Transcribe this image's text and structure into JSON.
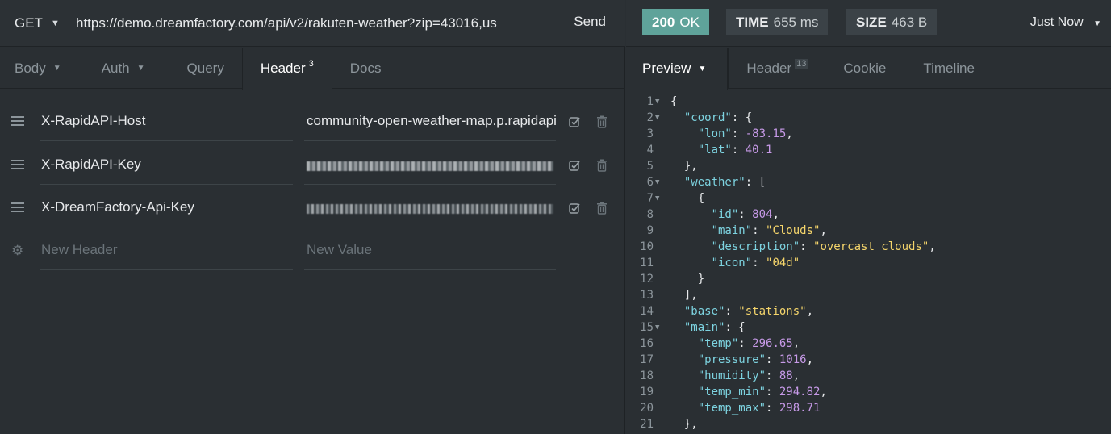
{
  "request": {
    "method": "GET",
    "url": "https://demo.dreamfactory.com/api/v2/rakuten-weather?zip=43016,us",
    "send_label": "Send"
  },
  "left_tabs": [
    {
      "label": "Body"
    },
    {
      "label": "Auth"
    },
    {
      "label": "Query"
    },
    {
      "label": "Header",
      "count": "3"
    },
    {
      "label": "Docs"
    }
  ],
  "headers": [
    {
      "name": "X-RapidAPI-Host",
      "value": "community-open-weather-map.p.rapidapi.com"
    },
    {
      "name": "X-RapidAPI-Key",
      "value": ""
    },
    {
      "name": "X-DreamFactory-Api-Key",
      "value": ""
    }
  ],
  "new_header": {
    "name_placeholder": "New Header",
    "value_placeholder": "New Value"
  },
  "response": {
    "status_code": "200",
    "status_text": "OK",
    "time_label": "TIME",
    "time_value": "655 ms",
    "size_label": "SIZE",
    "size_value": "463 B",
    "history": "Just Now"
  },
  "right_tabs": [
    {
      "label": "Preview"
    },
    {
      "label": "Header",
      "count": "13"
    },
    {
      "label": "Cookie"
    },
    {
      "label": "Timeline"
    }
  ],
  "code_lines": [
    {
      "n": "1",
      "fold": true,
      "html": "{"
    },
    {
      "n": "2",
      "fold": true,
      "html": "  <span class='k'>\"coord\"</span>: {"
    },
    {
      "n": "3",
      "fold": false,
      "html": "    <span class='k'>\"lon\"</span>: <span class='n'>-83.15</span>,"
    },
    {
      "n": "4",
      "fold": false,
      "html": "    <span class='k'>\"lat\"</span>: <span class='n'>40.1</span>"
    },
    {
      "n": "5",
      "fold": false,
      "html": "  },"
    },
    {
      "n": "6",
      "fold": true,
      "html": "  <span class='k'>\"weather\"</span>: ["
    },
    {
      "n": "7",
      "fold": true,
      "html": "    {"
    },
    {
      "n": "8",
      "fold": false,
      "html": "      <span class='k'>\"id\"</span>: <span class='n'>804</span>,"
    },
    {
      "n": "9",
      "fold": false,
      "html": "      <span class='k'>\"main\"</span>: <span class='s'>\"Clouds\"</span>,"
    },
    {
      "n": "10",
      "fold": false,
      "html": "      <span class='k'>\"description\"</span>: <span class='s'>\"overcast clouds\"</span>,"
    },
    {
      "n": "11",
      "fold": false,
      "html": "      <span class='k'>\"icon\"</span>: <span class='s'>\"04d\"</span>"
    },
    {
      "n": "12",
      "fold": false,
      "html": "    }"
    },
    {
      "n": "13",
      "fold": false,
      "html": "  ],"
    },
    {
      "n": "14",
      "fold": false,
      "html": "  <span class='k'>\"base\"</span>: <span class='s'>\"stations\"</span>,"
    },
    {
      "n": "15",
      "fold": true,
      "html": "  <span class='k'>\"main\"</span>: {"
    },
    {
      "n": "16",
      "fold": false,
      "html": "    <span class='k'>\"temp\"</span>: <span class='n'>296.65</span>,"
    },
    {
      "n": "17",
      "fold": false,
      "html": "    <span class='k'>\"pressure\"</span>: <span class='n'>1016</span>,"
    },
    {
      "n": "18",
      "fold": false,
      "html": "    <span class='k'>\"humidity\"</span>: <span class='n'>88</span>,"
    },
    {
      "n": "19",
      "fold": false,
      "html": "    <span class='k'>\"temp_min\"</span>: <span class='n'>294.82</span>,"
    },
    {
      "n": "20",
      "fold": false,
      "html": "    <span class='k'>\"temp_max\"</span>: <span class='n'>298.71</span>"
    },
    {
      "n": "21",
      "fold": false,
      "html": "  },"
    }
  ],
  "colors": {
    "accent_ok": "#5fa39a",
    "key": "#7dd3e0",
    "string": "#f5d56b",
    "number": "#c79ae8"
  }
}
